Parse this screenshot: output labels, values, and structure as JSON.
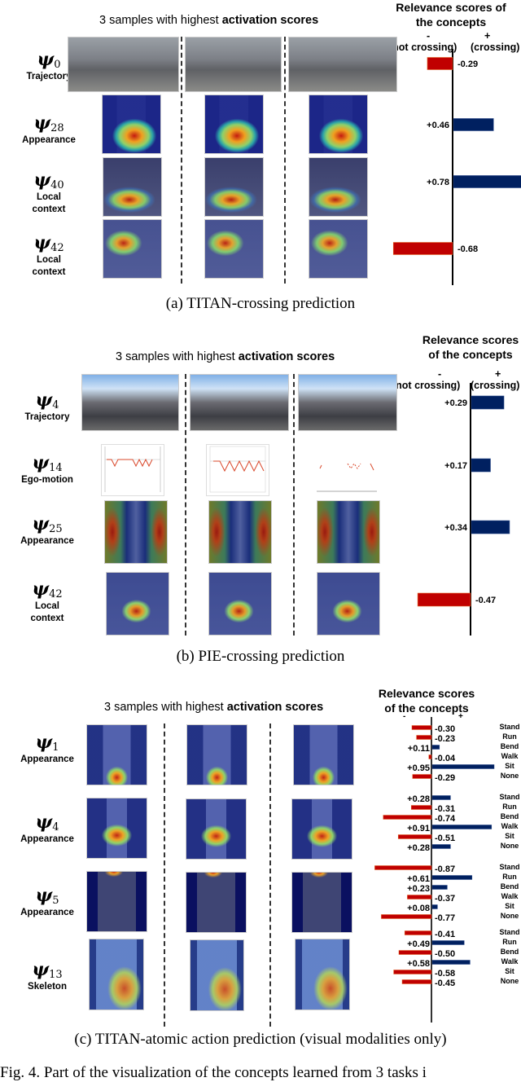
{
  "colors": {
    "negative": "#c00000",
    "positive": "#002060",
    "axis": "#000000"
  },
  "panels": [
    {
      "id": "a",
      "header_prefix": "3 samples with highest ",
      "header_bold": "activation scores",
      "relevance_title_line1": "Relevance scores of",
      "relevance_title_line2": "the concepts",
      "neg_sign": "-",
      "pos_sign": "+",
      "neg_label": "(not crossing)",
      "pos_label": "(crossing)",
      "rows": [
        {
          "psi": "ψ",
          "sub": "0",
          "modality": [
            "Trajectory"
          ],
          "thumb_kind": "street"
        },
        {
          "psi": "ψ",
          "sub": "28",
          "modality": [
            "Appearance"
          ],
          "thumb_kind": "heat-low"
        },
        {
          "psi": "ψ",
          "sub": "40",
          "modality": [
            "Local",
            "context"
          ],
          "thumb_kind": "heat-ground"
        },
        {
          "psi": "ψ",
          "sub": "42",
          "modality": [
            "Local",
            "context"
          ],
          "thumb_kind": "heat-left"
        }
      ],
      "caption": "(a) TITAN-crossing prediction"
    },
    {
      "id": "b",
      "header_prefix": "3 samples with highest ",
      "header_bold": "activation scores",
      "relevance_title_line1": "Relevance scores",
      "relevance_title_line2": "of the concepts",
      "neg_sign": "-",
      "pos_sign": "+",
      "neg_label": "(not crossing)",
      "pos_label": "(crossing)",
      "rows": [
        {
          "psi": "ψ",
          "sub": "4",
          "modality": [
            "Trajectory"
          ],
          "thumb_kind": "street sky"
        },
        {
          "psi": "ψ",
          "sub": "14",
          "modality": [
            "Ego-motion"
          ],
          "thumb_kind": "ego"
        },
        {
          "psi": "ψ",
          "sub": "25",
          "modality": [
            "Appearance"
          ],
          "thumb_kind": "heat-sides"
        },
        {
          "psi": "ψ",
          "sub": "42",
          "modality": [
            "Local",
            "context"
          ],
          "thumb_kind": "heat-feet"
        }
      ],
      "caption": "(b) PIE-crossing prediction"
    },
    {
      "id": "c",
      "header_prefix": "3 samples with highest ",
      "header_bold": "activation scores",
      "relevance_title_line1": "Relevance scores",
      "relevance_title_line2": "of the concepts",
      "neg_sign": "-",
      "pos_sign": "+",
      "rows": [
        {
          "psi": "ψ",
          "sub": "1",
          "modality": [
            "Appearance"
          ],
          "thumb_kind": "heat-bottom"
        },
        {
          "psi": "ψ",
          "sub": "4",
          "modality": [
            "Appearance"
          ],
          "thumb_kind": "heat-pelvis"
        },
        {
          "psi": "ψ",
          "sub": "5",
          "modality": [
            "Appearance"
          ],
          "thumb_kind": "heat-dark"
        },
        {
          "psi": "ψ",
          "sub": "13",
          "modality": [
            "Skeleton"
          ],
          "thumb_kind": "heat-skel"
        }
      ],
      "caption": "(c) TITAN-atomic action prediction (visual modalities only)"
    }
  ],
  "figure_caption_partial": "Fig. 4.  Part of the visualization of the concepts learned from 3 tasks i",
  "chart_data": [
    {
      "type": "bar",
      "orientation": "horizontal",
      "title": "Relevance scores of the concepts",
      "xlabel": "- (not crossing) | + (crossing)",
      "categories": [
        "ψ0 Trajectory",
        "ψ28 Appearance",
        "ψ40 Local context",
        "ψ42 Local context"
      ],
      "values": [
        -0.29,
        0.46,
        0.78,
        -0.68
      ],
      "value_labels": [
        "-0.29",
        "+0.46",
        "+0.78",
        "-0.68"
      ],
      "xlim": [
        -0.8,
        0.8
      ]
    },
    {
      "type": "bar",
      "orientation": "horizontal",
      "title": "Relevance scores of the concepts",
      "xlabel": "- (not crossing) | + (crossing)",
      "categories": [
        "ψ4 Trajectory",
        "ψ14 Ego-motion",
        "ψ25 Appearance",
        "ψ42 Local context"
      ],
      "values": [
        0.29,
        0.17,
        0.34,
        -0.47
      ],
      "value_labels": [
        "+0.29",
        "+0.17",
        "+0.34",
        "-0.47"
      ],
      "xlim": [
        -0.6,
        0.4
      ]
    },
    {
      "type": "bar",
      "orientation": "horizontal",
      "title": "Relevance scores of the concepts",
      "actions": [
        "Stand",
        "Run",
        "Bend",
        "Walk",
        "Sit",
        "None"
      ],
      "xlim": [
        -0.95,
        0.95
      ],
      "series": [
        {
          "name": "ψ1 Appearance",
          "values": [
            -0.3,
            -0.23,
            0.11,
            -0.04,
            0.95,
            -0.29
          ],
          "value_labels": [
            "-0.30",
            "-0.23",
            "+0.11",
            "-0.04",
            "+0.95",
            "-0.29"
          ]
        },
        {
          "name": "ψ4 Appearance",
          "values": [
            0.28,
            -0.31,
            -0.74,
            0.91,
            -0.51,
            0.28
          ],
          "value_labels": [
            "+0.28",
            "-0.31",
            "-0.74",
            "+0.91",
            "-0.51",
            "+0.28"
          ]
        },
        {
          "name": "ψ5 Appearance",
          "values": [
            -0.87,
            0.61,
            0.23,
            -0.37,
            0.08,
            -0.77
          ],
          "value_labels": [
            "-0.87",
            "+0.61",
            "+0.23",
            "-0.37",
            "+0.08",
            "-0.77"
          ]
        },
        {
          "name": "ψ13 Skeleton",
          "values": [
            -0.41,
            0.49,
            -0.5,
            0.58,
            -0.58,
            -0.45
          ],
          "value_labels": [
            "-0.41",
            "+0.49",
            "-0.50",
            "+0.58",
            "-0.58",
            "-0.45"
          ]
        }
      ]
    }
  ]
}
